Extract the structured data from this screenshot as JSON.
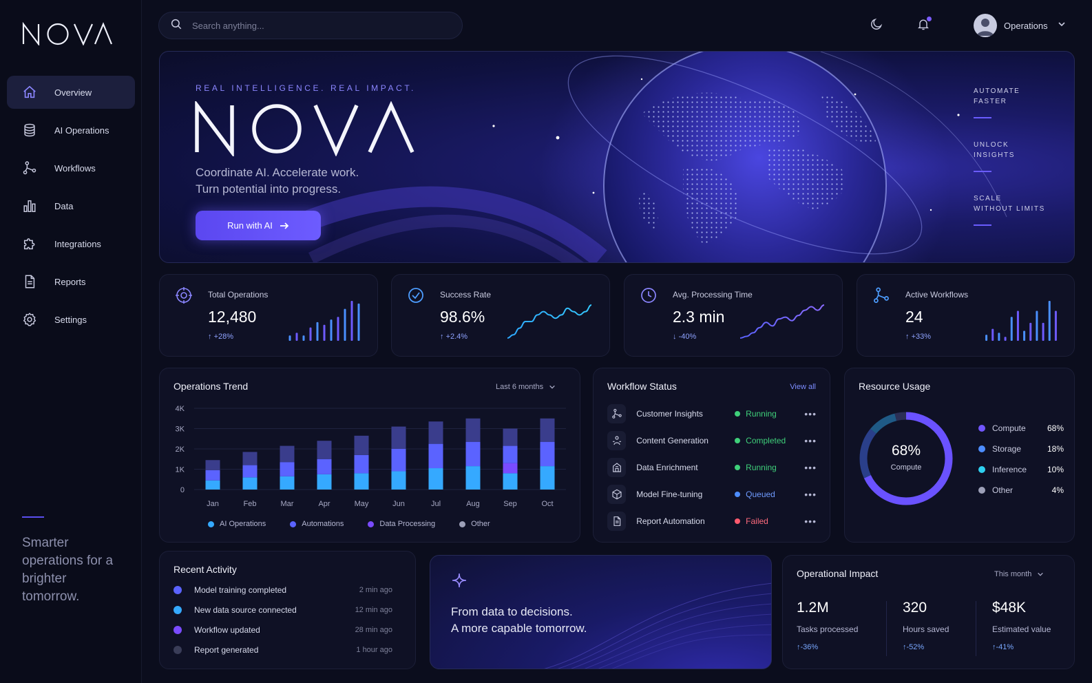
{
  "brand": {
    "name": "NOVA",
    "accent": "#6d5cff"
  },
  "sidebar": {
    "items": [
      {
        "label": "Overview",
        "icon": "home-icon",
        "active": true
      },
      {
        "label": "AI Operations",
        "icon": "database-icon"
      },
      {
        "label": "Workflows",
        "icon": "workflow-icon"
      },
      {
        "label": "Data",
        "icon": "bar-chart-icon"
      },
      {
        "label": "Integrations",
        "icon": "puzzle-icon"
      },
      {
        "label": "Reports",
        "icon": "document-icon"
      },
      {
        "label": "Settings",
        "icon": "gear-icon"
      }
    ],
    "tagline": "Smarter operations for a brighter tomorrow."
  },
  "topbar": {
    "search_placeholder": "Search anything...",
    "user_name": "Operations",
    "has_notification": true
  },
  "hero": {
    "eyebrow": "REAL INTELLIGENCE. REAL IMPACT.",
    "title": "NOVA",
    "subtitle_line1": "Coordinate AI. Accelerate work.",
    "subtitle_line2": "Turn potential into progress.",
    "button_label": "Run with AI",
    "side_items": [
      {
        "line1": "AUTOMATE",
        "line2": "FASTER"
      },
      {
        "line1": "UNLOCK",
        "line2": "INSIGHTS"
      },
      {
        "line1": "SCALE",
        "line2": "WITHOUT LIMITS"
      }
    ]
  },
  "kpis": [
    {
      "label": "Total Operations",
      "value": "12,480",
      "change": "+28%",
      "direction": "up",
      "icon": "target-icon",
      "spark_type": "bars",
      "spark": [
        2,
        3,
        2,
        5,
        7,
        6,
        8,
        9,
        12,
        15,
        14
      ]
    },
    {
      "label": "Success Rate",
      "value": "98.6%",
      "change": "+2.4%",
      "direction": "up",
      "icon": "check-circle-icon",
      "spark_type": "line",
      "spark": [
        1,
        2,
        4,
        6,
        6,
        8,
        9,
        8,
        7,
        8,
        10,
        9,
        8,
        9,
        11
      ]
    },
    {
      "label": "Avg. Processing Time",
      "value": "2.3 min",
      "change": "-40%",
      "direction": "down",
      "icon": "clock-icon",
      "spark_type": "line",
      "spark": [
        1,
        2,
        4,
        7,
        10,
        8,
        12,
        13,
        11,
        14,
        17,
        19,
        17,
        20
      ]
    },
    {
      "label": "Active Workflows",
      "value": "24",
      "change": "+33%",
      "direction": "up",
      "icon": "workflow-icon",
      "spark_type": "bars",
      "spark": [
        3,
        6,
        4,
        2,
        12,
        15,
        5,
        9,
        15,
        9,
        20,
        15
      ]
    }
  ],
  "operations_trend": {
    "title": "Operations Trend",
    "range": "Last 6 months",
    "chart_data": {
      "type": "bar",
      "stacked": true,
      "categories": [
        "Jan",
        "Feb",
        "Mar",
        "Apr",
        "May",
        "Jun",
        "Jul",
        "Aug",
        "Sep",
        "Oct"
      ],
      "ylim": [
        0,
        4000
      ],
      "yticks": [
        "0",
        "1K",
        "2K",
        "3K",
        "4K"
      ],
      "series": [
        {
          "name": "AI Operations",
          "color": "#35a9ff",
          "values": [
            450,
            600,
            650,
            750,
            800,
            900,
            1050,
            1150,
            800,
            1150
          ]
        },
        {
          "name": "Automations",
          "color": "#5b63ff",
          "values": [
            500,
            600,
            700,
            750,
            900,
            1100,
            1200,
            1200,
            850,
            1200
          ]
        },
        {
          "name": "Data Processing",
          "color": "#7a4bff",
          "values": [
            0,
            0,
            0,
            0,
            0,
            0,
            0,
            0,
            500,
            0
          ]
        },
        {
          "name": "Other",
          "color": "#3a3d8c",
          "values": [
            500,
            650,
            800,
            900,
            950,
            1100,
            1100,
            1150,
            850,
            1150
          ]
        }
      ]
    }
  },
  "workflow_status": {
    "title": "Workflow Status",
    "view_all": "View all",
    "rows": [
      {
        "name": "Customer Insights",
        "status": "Running",
        "color": "#3fd07a",
        "icon": "workflow-icon"
      },
      {
        "name": "Content Generation",
        "status": "Completed",
        "color": "#3fd07a",
        "icon": "user-workflow-icon"
      },
      {
        "name": "Data Enrichment",
        "status": "Running",
        "color": "#3fd07a",
        "icon": "building-icon"
      },
      {
        "name": "Model Fine-tuning",
        "status": "Queued",
        "color": "#4d8dff",
        "icon": "cube-icon"
      },
      {
        "name": "Report Automation",
        "status": "Failed",
        "color": "#ff5a6e",
        "icon": "document-icon"
      }
    ]
  },
  "resource_usage": {
    "title": "Resource Usage",
    "center_value": "68%",
    "center_label": "Compute",
    "items": [
      {
        "name": "Compute",
        "pct": "68%",
        "value": 68,
        "color": "#7156ff"
      },
      {
        "name": "Storage",
        "pct": "18%",
        "value": 18,
        "color": "#4d8dff"
      },
      {
        "name": "Inference",
        "pct": "10%",
        "value": 10,
        "color": "#2ed0f0"
      },
      {
        "name": "Other",
        "pct": "4%",
        "value": 4,
        "color": "#9da0b8"
      }
    ]
  },
  "recent_activity": {
    "title": "Recent Activity",
    "items": [
      {
        "text": "Model training completed",
        "time": "2 min ago",
        "color": "#5b63ff"
      },
      {
        "text": "New data source connected",
        "time": "12 min ago",
        "color": "#35a9ff"
      },
      {
        "text": "Workflow updated",
        "time": "28 min ago",
        "color": "#7a4bff"
      },
      {
        "text": "Report generated",
        "time": "1 hour ago",
        "color": "#3a3d58"
      }
    ]
  },
  "promo": {
    "line1": "From data to decisions.",
    "line2": "A more capable tomorrow."
  },
  "operational_impact": {
    "title": "Operational Impact",
    "range": "This month",
    "stats": [
      {
        "value": "1.2M",
        "label": "Tasks processed",
        "change": "-36%"
      },
      {
        "value": "320",
        "label": "Hours saved",
        "change": "-52%"
      },
      {
        "value": "$48K",
        "label": "Estimated value",
        "change": "-41%"
      }
    ]
  }
}
